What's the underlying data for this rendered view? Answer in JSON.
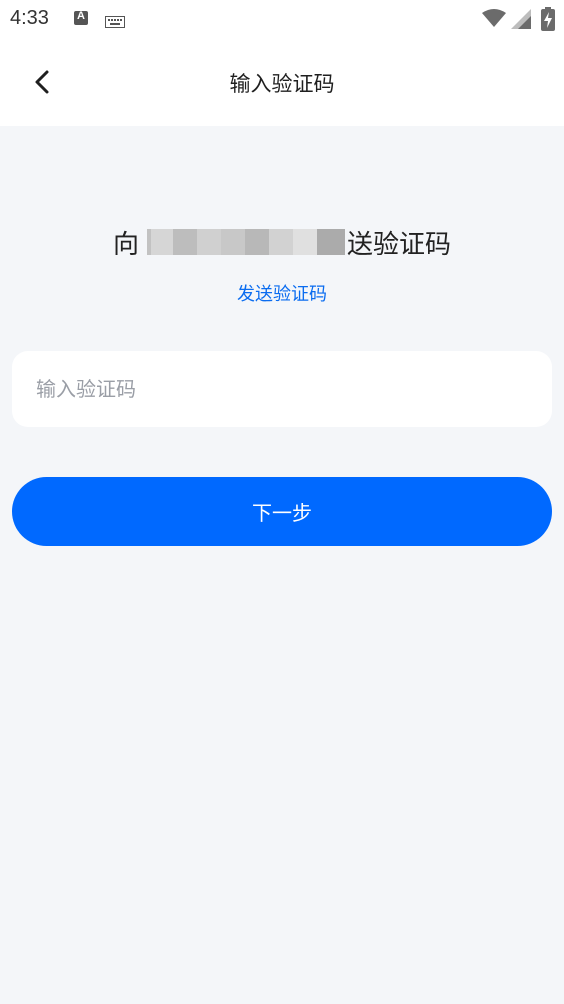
{
  "status_bar": {
    "time": "4:33",
    "icons": [
      "text-a-icon",
      "keyboard-icon",
      "wifi-icon",
      "cellular-signal-icon",
      "battery-charging-icon"
    ]
  },
  "header": {
    "title": "输入验证码",
    "back_icon": "chevron-left-icon"
  },
  "main": {
    "prompt_prefix": "向",
    "prompt_suffix": "送验证码",
    "send_code_link": "发送验证码",
    "code_input": {
      "placeholder": "输入验证码",
      "value": ""
    },
    "next_button": "下一步"
  },
  "colors": {
    "accent": "#0069ff",
    "link": "#0a6cf0",
    "background": "#f4f6f9",
    "surface": "#ffffff"
  }
}
